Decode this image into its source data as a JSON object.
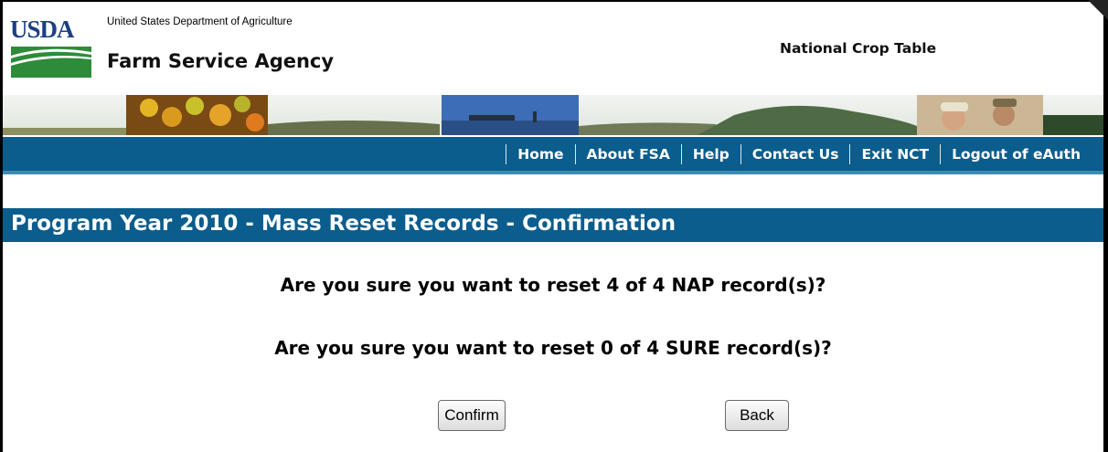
{
  "header": {
    "logo_text": "USDA",
    "department": "United States Department of Agriculture",
    "agency": "Farm Service Agency",
    "app_title": "National Crop Table"
  },
  "nav": {
    "items": [
      "Home",
      "About FSA",
      "Help",
      "Contact Us",
      "Exit NCT",
      "Logout of eAuth"
    ]
  },
  "page": {
    "title": "Program Year 2010 - Mass Reset Records - Confirmation",
    "questions": [
      "Are you sure you want to reset 4 of 4 NAP record(s)?",
      "Are you sure you want to reset 0 of 4 SURE record(s)?"
    ]
  },
  "buttons": {
    "confirm": "Confirm",
    "back": "Back"
  },
  "colors": {
    "nav_bg": "#0a5d8d",
    "logo_blue": "#1c3f84",
    "logo_green": "#2e8b3a"
  }
}
